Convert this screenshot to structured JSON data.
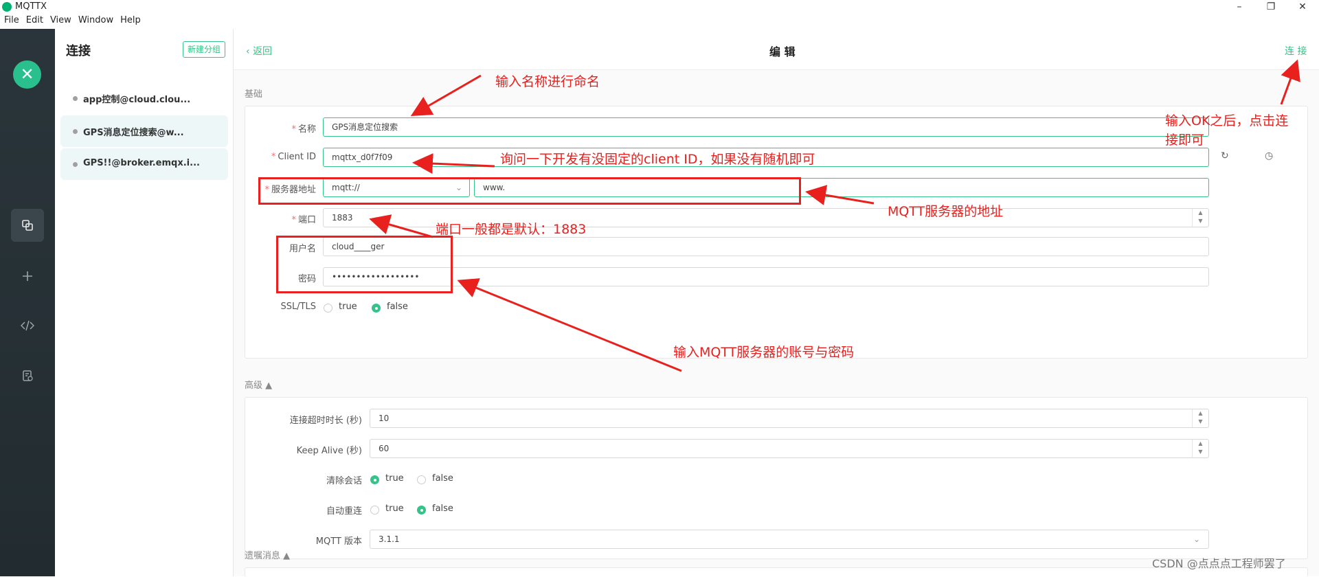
{
  "window": {
    "title": "MQTTX",
    "minimize": "–",
    "restore": "❐",
    "close": "✕"
  },
  "menu": [
    "File",
    "Edit",
    "View",
    "Window",
    "Help"
  ],
  "colors": {
    "accent": "#34c388",
    "sidebar": "#2a353b",
    "annotation": "#e8201e"
  },
  "sidebar": {
    "logo": "✕",
    "icons": [
      "connections-icon",
      "plus-icon",
      "code-icon",
      "log-icon"
    ]
  },
  "connections": {
    "title": "连接",
    "new_group": "新建分组",
    "items": [
      {
        "name": "app控制@cloud.clou..."
      },
      {
        "name": "GPS消息定位搜索@w..."
      },
      {
        "name": "GPS!!@broker.emqx.i..."
      }
    ]
  },
  "topbar": {
    "back": "返回",
    "title": "编 辑",
    "connect": "连 接"
  },
  "basic": {
    "section": "基础",
    "name_label": "名称",
    "name_value": "GPS消息定位搜索",
    "clientid_label": "Client ID",
    "clientid_value": "mqttx_d0f7f09",
    "server_label": "服务器地址",
    "protocol_value": "mqtt://",
    "host_value": "www.",
    "port_label": "端口",
    "port_value": "1883",
    "username_label": "用户名",
    "username_value": "cloud____ger",
    "password_label": "密码",
    "password_value": "••••••••••••••••••",
    "ssl_label": "SSL/TLS",
    "true_label": "true",
    "false_label": "false"
  },
  "advanced": {
    "section": "高级 ▲",
    "timeout_label": "连接超时时长 (秒)",
    "timeout_value": "10",
    "keepalive_label": "Keep Alive (秒)",
    "keepalive_value": "60",
    "clean_label": "清除会话",
    "reconnect_label": "自动重连",
    "true_label": "true",
    "false_label": "false",
    "version_label": "MQTT 版本",
    "version_value": "3.1.1"
  },
  "lastwill": {
    "section": "遗嘱消息 ▲"
  },
  "annotations": {
    "name_tip": "输入名称进行命名",
    "clientid_tip": "询问一下开发有没固定的client ID，如果没有随机即可",
    "server_tip": "MQTT服务器的地址",
    "port_tip": "端口一般都是默认：1883",
    "account_tip": "输入MQTT服务器的账号与密码",
    "connect_tip_line1": "输入OK之后，点击连",
    "connect_tip_line2": "接即可"
  },
  "watermark": "CSDN @点点点工程师罢了"
}
